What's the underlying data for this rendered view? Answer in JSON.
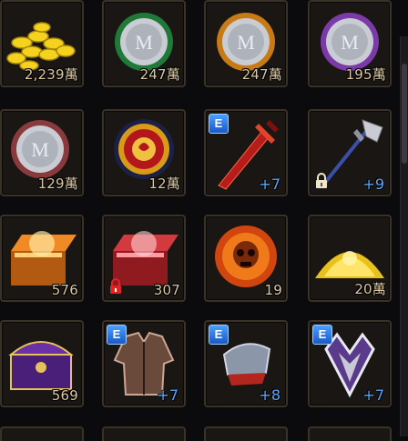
{
  "inventory": {
    "slots": [
      {
        "icon": "gold-coins-icon",
        "count": "2,239萬"
      },
      {
        "icon": "green-coin-icon",
        "count": "247萬"
      },
      {
        "icon": "orange-coin-icon",
        "count": "247萬"
      },
      {
        "icon": "purple-coin-icon",
        "count": "195萬"
      },
      {
        "icon": "red-coin-icon",
        "count": "129萬"
      },
      {
        "icon": "lion-medal-icon",
        "count": "12萬"
      },
      {
        "icon": "red-sword-icon",
        "badge": "E",
        "enhance": "+7"
      },
      {
        "icon": "halberd-icon",
        "enhance": "+9",
        "locked": true
      },
      {
        "icon": "orange-chest-icon",
        "count": "576"
      },
      {
        "icon": "red-chest-icon",
        "count": "307",
        "locked": true
      },
      {
        "icon": "skull-orb-icon",
        "count": "19"
      },
      {
        "icon": "gold-pile-icon",
        "count": "20萬"
      },
      {
        "icon": "purple-chest-icon",
        "count": "569"
      },
      {
        "icon": "leather-armor-icon",
        "badge": "E",
        "enhance": "+7"
      },
      {
        "icon": "gauntlet-icon",
        "badge": "E",
        "enhance": "+8"
      },
      {
        "icon": "crest-icon",
        "badge": "E",
        "enhance": "+7"
      }
    ]
  },
  "colors": {
    "gold": "#e8c23a",
    "count_text": "#d9c7a5",
    "enhance": "#59a6ff",
    "badge": "#2d7be0"
  }
}
